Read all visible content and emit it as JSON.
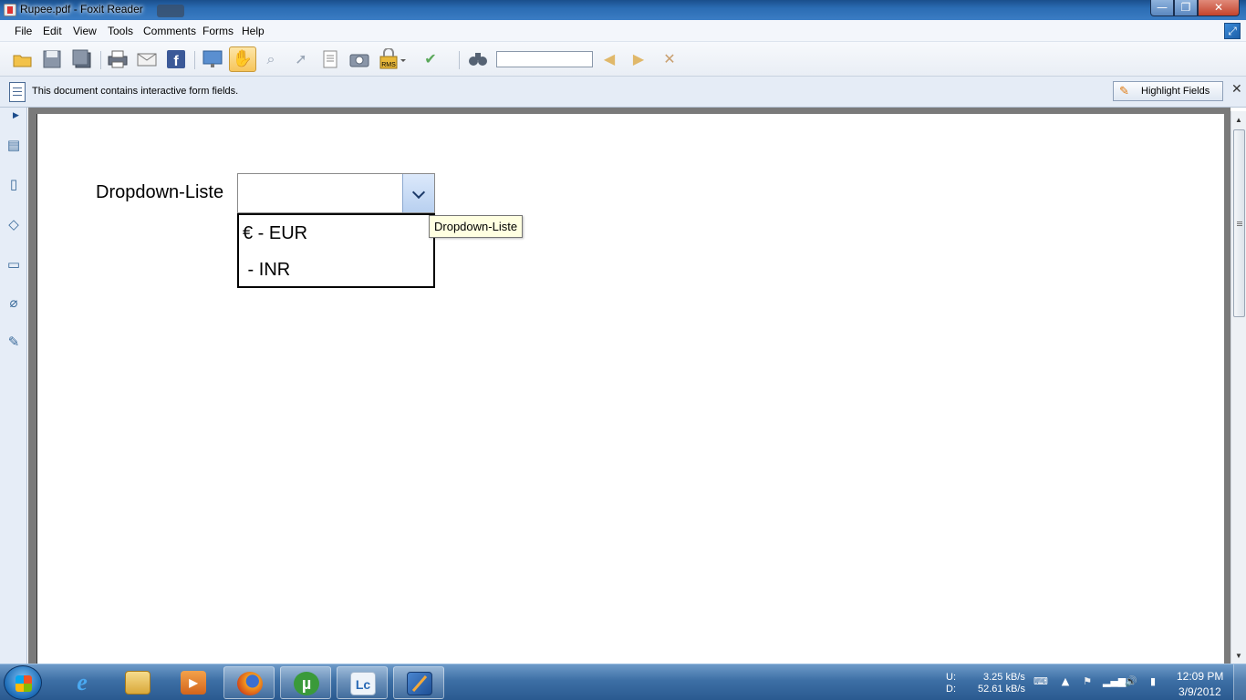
{
  "window": {
    "title": "Rupee.pdf - Foxit Reader",
    "buttons": {
      "minimize": "—",
      "maximize": "❐",
      "close": "✕"
    }
  },
  "menu": [
    {
      "label": "File"
    },
    {
      "label": "Edit"
    },
    {
      "label": "View"
    },
    {
      "label": "Tools"
    },
    {
      "label": "Comments"
    },
    {
      "label": "Forms"
    },
    {
      "label": "Help"
    }
  ],
  "toolbar": {
    "find_value": "",
    "tools": [
      {
        "name": "open-icon"
      },
      {
        "name": "save-icon"
      },
      {
        "name": "save-all-icon"
      },
      {
        "name": "print-icon"
      },
      {
        "name": "email-icon"
      },
      {
        "name": "facebook-icon"
      },
      {
        "name": "presentation-icon"
      },
      {
        "name": "hand-tool-icon",
        "active": true
      },
      {
        "name": "zoom-tool-icon"
      },
      {
        "name": "select-tool-icon"
      },
      {
        "name": "text-select-icon"
      },
      {
        "name": "snapshot-icon"
      },
      {
        "name": "rms-icon"
      },
      {
        "name": "sign-icon"
      },
      {
        "name": "find-binoculars-icon"
      },
      {
        "name": "find-prev-icon"
      },
      {
        "name": "find-next-icon"
      },
      {
        "name": "find-clear-icon"
      }
    ]
  },
  "infobar": {
    "message": "This document contains interactive form fields.",
    "highlight_button": "Highlight Fields",
    "close": "✕"
  },
  "leftnav": {
    "toggle": "▶",
    "buttons": [
      {
        "name": "bookmarks-icon",
        "glyph": "▤"
      },
      {
        "name": "pages-icon",
        "glyph": "▯"
      },
      {
        "name": "layers-icon",
        "glyph": "◇"
      },
      {
        "name": "comments-icon",
        "glyph": "▭"
      },
      {
        "name": "attachments-icon",
        "glyph": "⌀"
      },
      {
        "name": "signatures-icon",
        "glyph": "✎"
      }
    ]
  },
  "form": {
    "label": "Dropdown-Liste",
    "selected_value": "",
    "options": [
      "€ - EUR",
      " - INR"
    ],
    "tooltip": "Dropdown-Liste"
  },
  "taskbar": {
    "apps": [
      {
        "name": "internet-explorer-icon",
        "label": "e",
        "color": "#2a7fd4",
        "running": false
      },
      {
        "name": "explorer-folder-icon",
        "label": "",
        "color": "#e7c26a",
        "running": false
      },
      {
        "name": "media-player-icon",
        "label": "▶",
        "color": "#e07a2a",
        "running": false
      },
      {
        "name": "firefox-icon",
        "label": "",
        "color": "#e2661c",
        "running": true
      },
      {
        "name": "utorrent-icon",
        "label": "µ",
        "color": "#3a9a3a",
        "running": true
      },
      {
        "name": "lc-app-icon",
        "label": "Lc",
        "color": "#e8eef6",
        "running": true
      },
      {
        "name": "foxit-reader-icon",
        "label": "",
        "color": "#2a5fa5",
        "running": true
      }
    ],
    "net_up_label": "U:",
    "net_up_value": "3.25 kB/s",
    "net_down_label": "D:",
    "net_down_value": "52.61 kB/s",
    "time": "12:09 PM",
    "date": "3/9/2012"
  },
  "colors": {
    "accent": "#3b7dc4",
    "taskbar": "#3d6fa5",
    "tooltip_bg": "#ffffe1"
  }
}
